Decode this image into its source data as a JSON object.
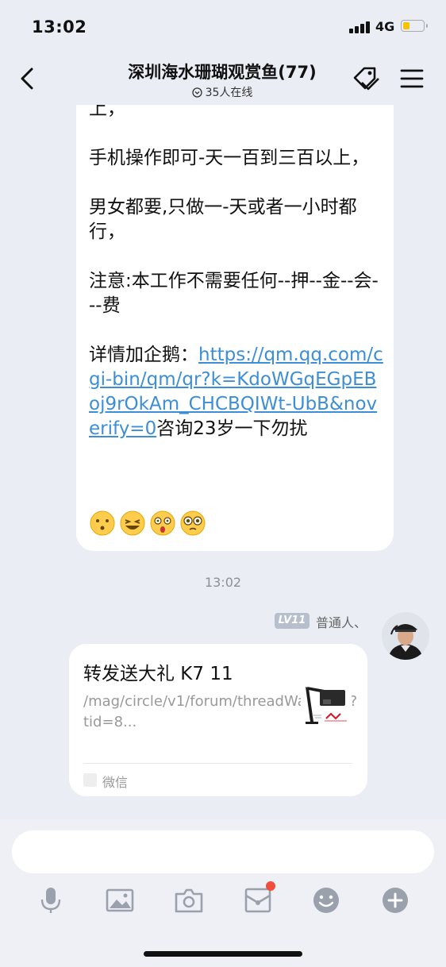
{
  "status_bar": {
    "time": "13:02",
    "network": "4G",
    "battery_level": 0.3
  },
  "nav": {
    "title": "深圳海水珊瑚观赏鱼(77)",
    "online": "35人在线",
    "back_icon": "chevron-left-icon",
    "tag_icon": "tag-icon",
    "menu_icon": "hamburger-menu-icon"
  },
  "messages": {
    "text_lines_before": "上，\n\n手机操作即可-天一百到三百以上，\n\n男女都要,只做一-天或者一小时都行，\n\n注意:本工作不需要任何--押--金--会---费\n\n详情加企鹅：",
    "link": "https://qm.qq.com/cgi-bin/qm/qr?k=KdoWGqEGpEBoj9rOkAm_CHCBQIWt-UbB&noverify=0",
    "text_after_link": "咨询23岁一下勿扰",
    "emojis": [
      "face-blowing-icon",
      "grinning-squint-icon",
      "shocked-face-icon",
      "dizzy-eyes-icon"
    ]
  },
  "time_divider": "13:02",
  "sender": {
    "level": "LV11",
    "name": "普通人、"
  },
  "card": {
    "title": "转发送大礼 K7 11",
    "desc": "/mag/circle/v1/forum/threadWapPage?tid=8...",
    "source": "微信"
  },
  "input": {
    "placeholder": ""
  },
  "toolbar": {
    "icons": [
      "microphone-icon",
      "image-icon",
      "camera-icon",
      "red-packet-icon",
      "emoji-icon",
      "plus-icon"
    ]
  },
  "colors": {
    "background": "#ebedf5",
    "link": "#3c8ed6",
    "badge": "#b8bfcc",
    "notification": "#f04d3c",
    "battery": "#f5c400"
  }
}
